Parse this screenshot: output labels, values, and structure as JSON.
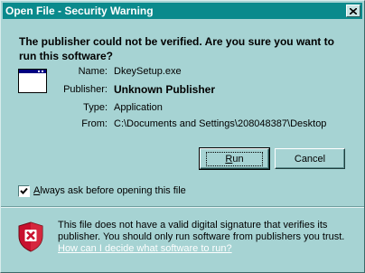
{
  "window": {
    "title": "Open File - Security Warning",
    "close_icon": "close-icon"
  },
  "headline": "The publisher could not be verified.  Are you sure you want to run this software?",
  "details": {
    "name_label": "Name:",
    "name_value": "DkeySetup.exe",
    "publisher_label": "Publisher:",
    "publisher_value": "Unknown Publisher",
    "type_label": "Type:",
    "type_value": "Application",
    "from_label": "From:",
    "from_value": "C:\\Documents and Settings\\208048387\\Desktop"
  },
  "buttons": {
    "run_access_key": "R",
    "run_rest": "un",
    "cancel_label": "Cancel"
  },
  "option": {
    "checked": true,
    "label_access_key": "A",
    "label_rest": "lways ask before opening this file"
  },
  "warning": {
    "text": "This file does not have a valid digital signature that verifies its publisher.  You should only run software from publishers you trust.",
    "link_text": "How can I decide what software to run?",
    "icon": "shield-error-icon"
  },
  "colors": {
    "titlebar": "#0a8a8c",
    "dialog_bg": "#a6d3d3",
    "shield_red": "#c8102e"
  }
}
